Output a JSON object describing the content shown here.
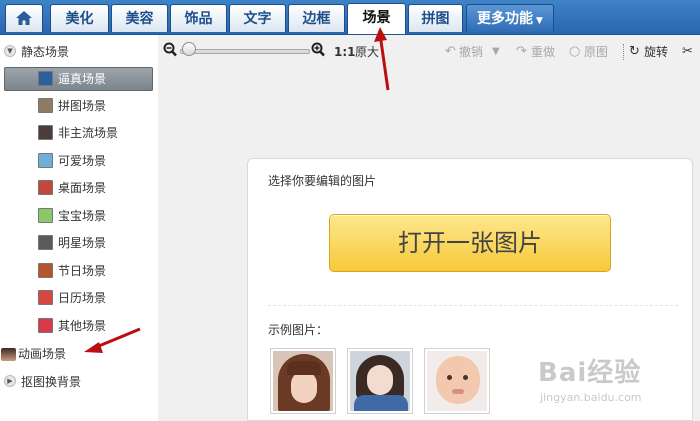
{
  "nav": {
    "home_icon": "home-icon",
    "tabs": [
      "美化",
      "美容",
      "饰品",
      "文字",
      "边框",
      "场景",
      "拼图"
    ],
    "active_tab": "场景",
    "more_label": "更多功能"
  },
  "sidebar": {
    "static_section": "静态场景",
    "items": [
      {
        "label": "逼真场景",
        "icon_color": "#2c5f9e"
      },
      {
        "label": "拼图场景",
        "icon_color": "#8f7a63"
      },
      {
        "label": "非主流场景",
        "icon_color": "#4a3d3a"
      },
      {
        "label": "可爱场景",
        "icon_color": "#6fb0d6"
      },
      {
        "label": "桌面场景",
        "icon_color": "#c4483a"
      },
      {
        "label": "宝宝场景",
        "icon_color": "#8cc86a"
      },
      {
        "label": "明星场景",
        "icon_color": "#5b5b5b"
      },
      {
        "label": "节日场景",
        "icon_color": "#b5552f"
      },
      {
        "label": "日历场景",
        "icon_color": "#d8473f"
      },
      {
        "label": "其他场景",
        "icon_color": "#d93a4a"
      }
    ],
    "selected_item": "逼真场景",
    "animated_section": "动画场景",
    "cutout_section": "抠图换背景"
  },
  "toolbar": {
    "zoom_out_icon": "zoom-out-icon",
    "zoom_in_icon": "zoom-in-icon",
    "ratio": "1:1",
    "original_size": "原大",
    "undo": "撤销",
    "redo": "重做",
    "original": "原图",
    "rotate": "旋转",
    "cut_icon": "scissors-icon"
  },
  "panel": {
    "title": "选择你要编辑的图片",
    "open_button": "打开一张图片",
    "examples_label": "示例图片："
  },
  "watermark": {
    "main": "Bai经验",
    "sub": "jingyan.baidu.com"
  },
  "colors": {
    "nav_blue": "#2f6db5",
    "button_yellow": "#f7c83a",
    "selected_gray": "#8a9199",
    "arrow_red": "#b81010"
  }
}
